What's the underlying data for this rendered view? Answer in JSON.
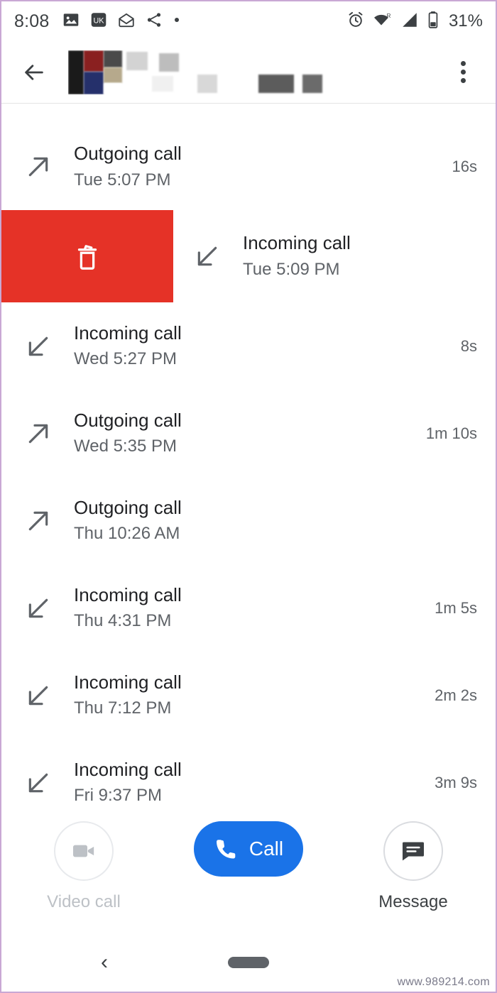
{
  "statusbar": {
    "time": "8:08",
    "left_icons": [
      "image-icon",
      "app-badge-icon",
      "mail-icon",
      "share-icon",
      "dot-icon"
    ],
    "right_icons": [
      "alarm-icon",
      "wifi-roaming-icon",
      "signal-icon",
      "battery-icon"
    ],
    "battery": "31%"
  },
  "appbar": {
    "back_label": "back-arrow",
    "title": "",
    "overflow_label": "more-options"
  },
  "calls": [
    {
      "type": "Outgoing call",
      "when": "Tue 5:07 PM",
      "duration": "16s",
      "direction": "outgoing"
    },
    {
      "type": "Incoming call",
      "when": "Tue 5:09 PM",
      "duration": "",
      "direction": "incoming",
      "swiped": true,
      "action": "delete"
    },
    {
      "type": "Incoming call",
      "when": "Wed 5:27 PM",
      "duration": "8s",
      "direction": "incoming"
    },
    {
      "type": "Outgoing call",
      "when": "Wed 5:35 PM",
      "duration": "1m 10s",
      "direction": "outgoing"
    },
    {
      "type": "Outgoing call",
      "when": "Thu 10:26 AM",
      "duration": "",
      "direction": "outgoing"
    },
    {
      "type": "Incoming call",
      "when": "Thu 4:31 PM",
      "duration": "1m 5s",
      "direction": "incoming"
    },
    {
      "type": "Incoming call",
      "when": "Thu 7:12 PM",
      "duration": "2m 2s",
      "direction": "incoming"
    },
    {
      "type": "Incoming call",
      "when": "Fri 9:37 PM",
      "duration": "3m 9s",
      "direction": "incoming"
    }
  ],
  "actions": {
    "video": {
      "label": "Video call",
      "icon": "video-camera-icon",
      "enabled": false
    },
    "call": {
      "label": "Call",
      "icon": "phone-icon",
      "enabled": true
    },
    "message": {
      "label": "Message",
      "icon": "message-bubble-icon",
      "enabled": true
    }
  },
  "navbar": {
    "back": "‹",
    "home": "home-pill"
  },
  "colors": {
    "delete_red": "#e53227",
    "call_blue": "#1a73e8",
    "primary_text": "#202124",
    "secondary_text": "#5f6368"
  },
  "watermark": "www.989214.com"
}
